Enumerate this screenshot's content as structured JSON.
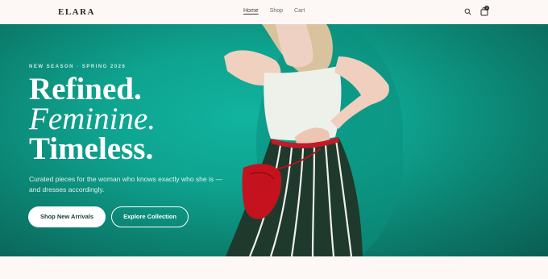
{
  "header": {
    "logo": "ELARA",
    "nav": [
      {
        "label": "Home"
      },
      {
        "label": "Shop"
      },
      {
        "label": "Cart"
      }
    ],
    "cart_count": "3"
  },
  "hero": {
    "eyebrow": "NEW SEASON · SPRING 2026",
    "headline": {
      "line1": "Refined.",
      "line2": "Feminine.",
      "line3": "Timeless."
    },
    "subtext": "Curated pieces for the woman who knows exactly who she is — and dresses accordingly.",
    "primary_button": "Shop New Arrivals",
    "secondary_button": "Explore Collection"
  },
  "colors": {
    "accent": "#0ea38f",
    "cream": "#fdf8f6",
    "dark": "#2a2424"
  }
}
